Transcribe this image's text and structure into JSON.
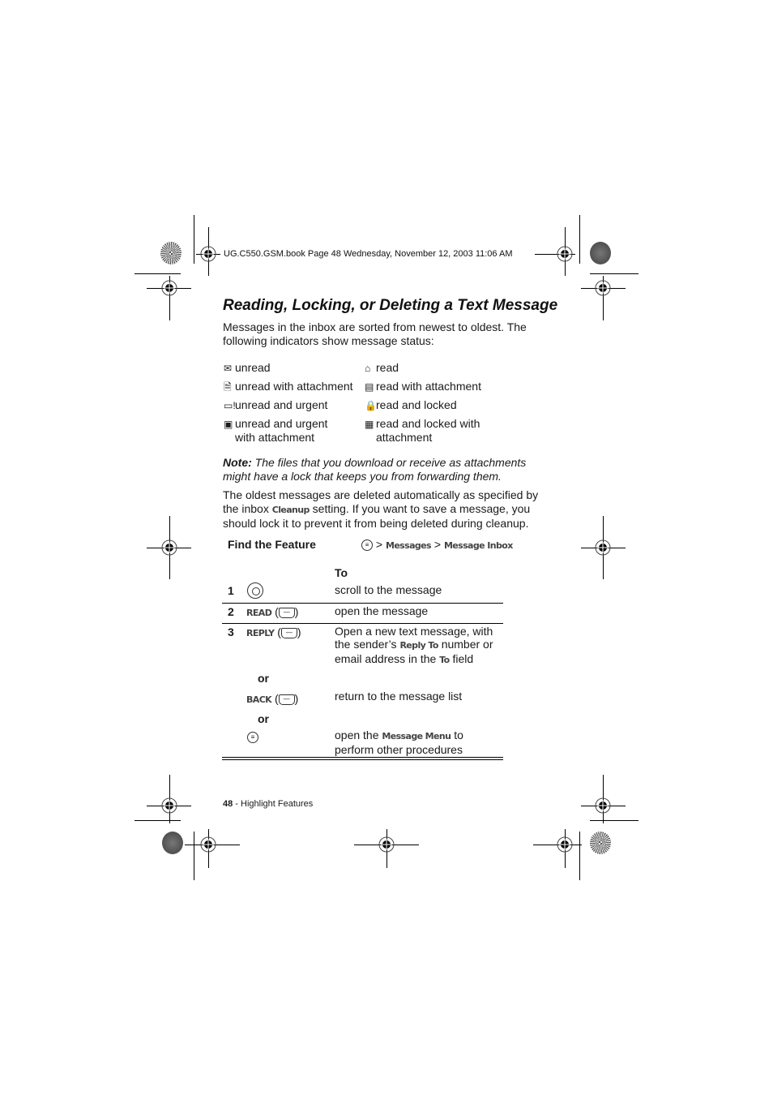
{
  "header": {
    "book_info": "UG.C550.GSM.book  Page 48  Wednesday, November 12, 2003  11:06 AM"
  },
  "section": {
    "title": "Reading, Locking, or Deleting a Text Message",
    "intro": "Messages in the inbox are sorted from newest to oldest. The following indicators show message status:"
  },
  "indicators": [
    {
      "icon": "envelope-closed-icon",
      "glyph": "✉",
      "label": "unread"
    },
    {
      "icon": "envelope-open-icon",
      "glyph": "⌂",
      "label": "read"
    },
    {
      "icon": "envelope-attachment-icon",
      "glyph": "🗎",
      "label": "unread with attachment"
    },
    {
      "icon": "open-attachment-icon",
      "glyph": "▤",
      "label": "read with attachment"
    },
    {
      "icon": "envelope-urgent-icon",
      "glyph": "▭!",
      "label": "unread and urgent"
    },
    {
      "icon": "lock-icon",
      "glyph": "🔒",
      "label": "read and locked"
    },
    {
      "icon": "envelope-urgent-attachment-icon",
      "glyph": "▣",
      "label": "unread and urgent with attachment"
    },
    {
      "icon": "lock-attachment-icon",
      "glyph": "▦",
      "label": "read and locked with attachment"
    }
  ],
  "note": {
    "label": "Note:",
    "text": " The files that you download or receive as attachments might have a lock that keeps you from forwarding them."
  },
  "cleanup_para": {
    "part1": "The oldest messages are deleted automatically as specified by the inbox ",
    "keyword": "Cleanup",
    "part2": " setting. If you want to save a message, you should lock it to prevent it from being deleted during cleanup."
  },
  "find_feature": {
    "label": "Find the Feature",
    "menu_glyph": "≡",
    "separator": ">",
    "path": [
      "Messages",
      "Message Inbox"
    ]
  },
  "table": {
    "column_header": "To",
    "rows": [
      {
        "step": "1",
        "key": "",
        "key_icon": "nav-key-icon",
        "action": "scroll to the message"
      },
      {
        "step": "2",
        "key": "READ",
        "key_icon": "softkey-icon",
        "action": "open the message"
      },
      {
        "step": "3",
        "key": "REPLY",
        "key_icon": "softkey-icon",
        "action_part1": "Open a new text message, with the sender’s ",
        "action_kw1": "Reply To",
        "action_part2": " number or email address in the ",
        "action_kw2": "To",
        "action_part3": " field"
      },
      {
        "step": "",
        "or": "or",
        "key": "BACK",
        "key_icon": "softkey-icon",
        "action": "return to the message list"
      },
      {
        "step": "",
        "or": "or",
        "key": "",
        "key_icon": "menu-key-icon",
        "action_part1": "open the ",
        "action_kw1": "Message Menu",
        "action_part2": " to perform other procedures"
      }
    ]
  },
  "footer": {
    "page_number": "48",
    "section": " - Highlight Features"
  }
}
